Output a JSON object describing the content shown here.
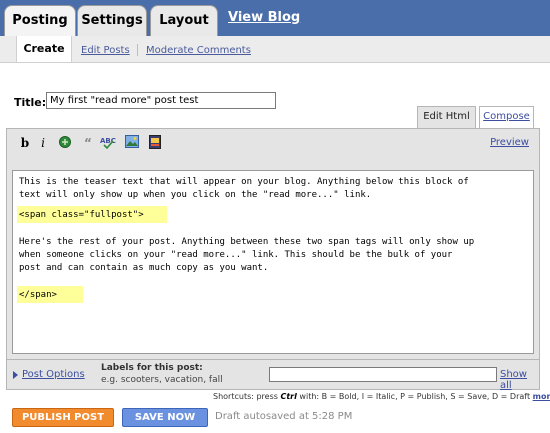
{
  "top_tabs": {
    "posting": "Posting",
    "settings": "Settings",
    "layout": "Layout",
    "view_blog": "View Blog"
  },
  "sub_tabs": {
    "create": "Create",
    "edit_posts": "Edit Posts",
    "moderate_comments": "Moderate Comments"
  },
  "title_field": {
    "label": "Title:",
    "value": "My first \"read more\" post test"
  },
  "editor_modes": {
    "edit_html": "Edit Html",
    "compose": "Compose"
  },
  "toolbar": {
    "bold": "b",
    "italic": "i",
    "preview": "Preview",
    "icons": [
      "link-icon",
      "blockquote-icon",
      "spellcheck-icon",
      "image-icon",
      "video-icon"
    ]
  },
  "editor_content": {
    "line1": "This is the teaser text that will appear on your blog. Anything below this block of",
    "line2": "text will only show up when you click on the \"read more...\" link.",
    "line3": "<span class=\"fullpost\">",
    "line4": "Here's the rest of your post. Anything between these two span tags will only show up",
    "line5": "when someone clicks on your \"read more...\" link. This should be the bulk of your",
    "line6": "post and can contain as much copy as you want.",
    "line7": "</span>"
  },
  "post_options": {
    "link": "Post Options",
    "labels_title": "Labels for this post:",
    "labels_example": "e.g. scooters, vacation, fall",
    "labels_value": "",
    "show_all": "Show all"
  },
  "shortcuts": {
    "prefix": "Shortcuts: press",
    "key": "Ctrl",
    "with": "with:",
    "text": "B = Bold, I = Italic, P = Publish, S = Save, D = Draft",
    "more": "more"
  },
  "buttons": {
    "publish": "PUBLISH POST",
    "save": "SAVE NOW"
  },
  "status": {
    "draft": "Draft autosaved at 5:28 PM"
  },
  "colors": {
    "top_bar": "#4a6ea9",
    "publish": "#f28a2e",
    "save": "#6b92e0",
    "highlight": "#ffff99",
    "link": "#3b4ea0"
  }
}
